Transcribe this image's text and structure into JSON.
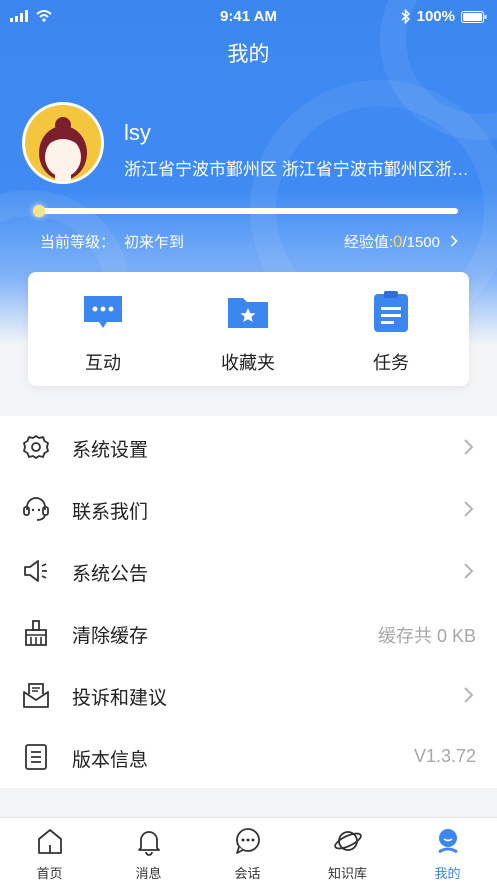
{
  "status_bar": {
    "time": "9:41 AM",
    "battery": "100%"
  },
  "header": {
    "title": "我的"
  },
  "profile": {
    "username": "lsy",
    "address": "浙江省宁波市鄞州区 浙江省宁波市鄞州区浙江省宁波市鄞州区",
    "level_label": "当前等级：",
    "level_value": "初来乍到",
    "exp_label": "经验值:",
    "exp_current": "0",
    "exp_max": "/1500",
    "exp_progress": 0
  },
  "shortcuts": [
    {
      "label": "互动",
      "icon": "chat-bubble-icon"
    },
    {
      "label": "收藏夹",
      "icon": "star-folder-icon"
    },
    {
      "label": "任务",
      "icon": "clipboard-icon"
    }
  ],
  "menu": [
    {
      "label": "系统设置",
      "icon": "gear-icon"
    },
    {
      "label": "联系我们",
      "icon": "headset-icon"
    },
    {
      "label": "系统公告",
      "icon": "speaker-icon"
    },
    {
      "label": "清除缓存",
      "icon": "broom-icon",
      "value": "缓存共 0 KB"
    },
    {
      "label": "投诉和建议",
      "icon": "mail-icon"
    },
    {
      "label": "版本信息",
      "icon": "document-icon",
      "value": "V1.3.72"
    }
  ],
  "tabs": [
    {
      "label": "首页",
      "icon": "home-icon"
    },
    {
      "label": "消息",
      "icon": "bell-icon"
    },
    {
      "label": "会话",
      "icon": "chat-icon"
    },
    {
      "label": "知识库",
      "icon": "planet-icon"
    },
    {
      "label": "我的",
      "icon": "profile-icon",
      "active": true
    }
  ],
  "colors": {
    "primary": "#3c86f0",
    "accent": "#f6d35b",
    "muted": "#a7a7a7"
  }
}
